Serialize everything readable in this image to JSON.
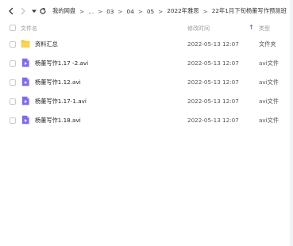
{
  "toolbar": {
    "breadcrumbs": [
      "我的网盘",
      "...",
      "03",
      "04",
      "05",
      "2022年雅思",
      "22年1月下旬杨董写作预测班"
    ],
    "separator": ">",
    "trailing_separator": ">"
  },
  "header": {
    "name_label": "文件名",
    "time_label": "修改时间",
    "type_label": "类型",
    "sort_indicator": "↑"
  },
  "files": [
    {
      "name": "资料汇总",
      "time": "2022-05-13 12:07",
      "type": "文件夹",
      "icon": "folder-icon"
    },
    {
      "name": "杨董写作1.17 -2.avi",
      "time": "2022-05-13 12:07",
      "type": "avi文件",
      "icon": "video-file-icon"
    },
    {
      "name": "杨董写作1.12.avi",
      "time": "2022-05-13 12:07",
      "type": "avi文件",
      "icon": "video-file-icon"
    },
    {
      "name": "杨董写作1.17-1.avi",
      "time": "2022-05-13 12:07",
      "type": "avi文件",
      "icon": "video-file-icon"
    },
    {
      "name": "杨董写作1.18.avi",
      "time": "2022-05-13 12:07",
      "type": "avi文件",
      "icon": "video-file-icon"
    }
  ],
  "colors": {
    "folder": "#f9c33d",
    "video": "#7e6bf2",
    "accent": "#3a82f7"
  }
}
